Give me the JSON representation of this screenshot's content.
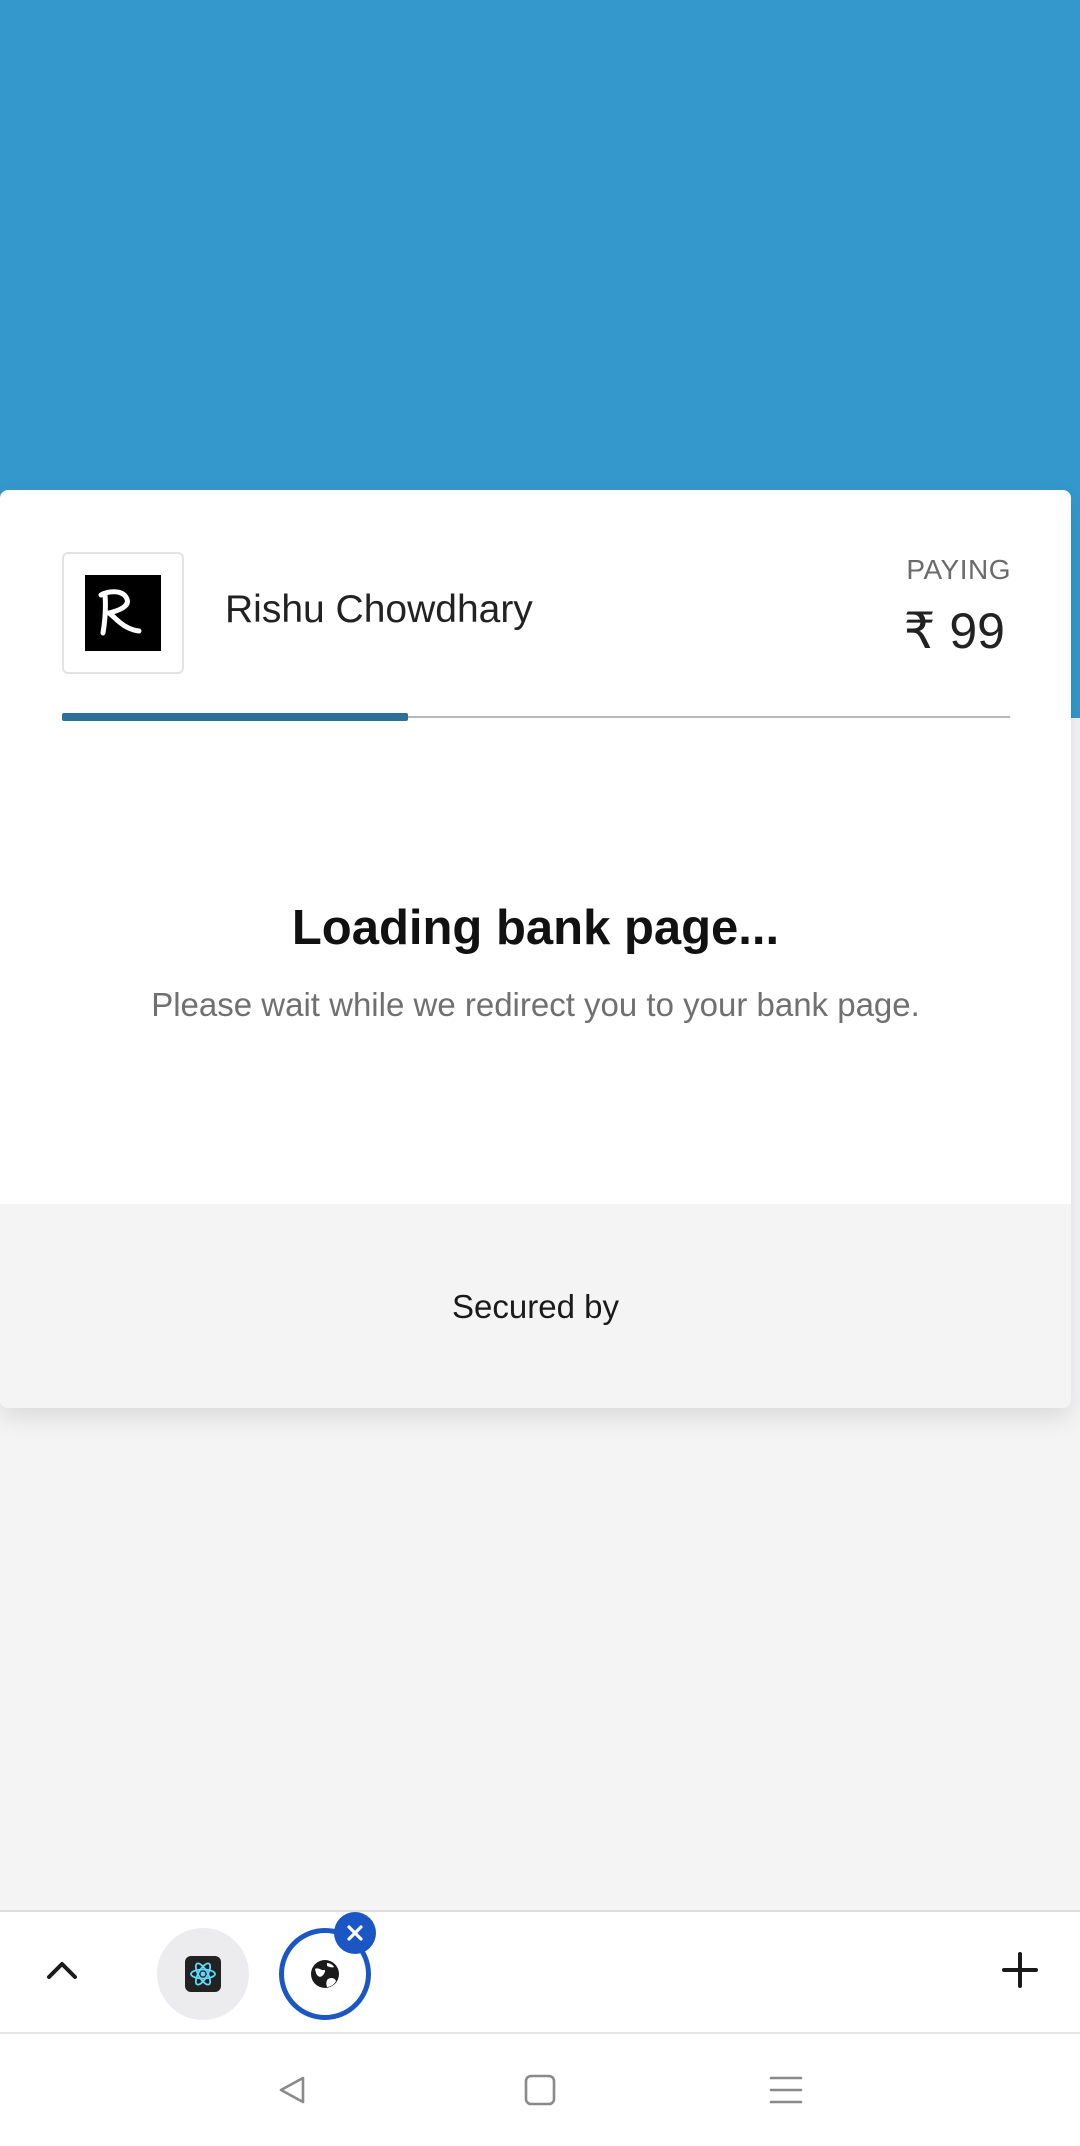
{
  "merchant": {
    "name": "Rishu Chowdhary",
    "logo_text": "R"
  },
  "payment": {
    "paying_label": "PAYING",
    "amount": "₹ 99"
  },
  "progress": {
    "value_percent": 36.5
  },
  "status": {
    "title": "Loading bank page...",
    "subtitle": "Please wait while we redirect you to your bank page."
  },
  "footer": {
    "secured_by": "Secured by"
  },
  "colors": {
    "header_band": "#3498cc",
    "progress_fill": "#2c6f97",
    "tab_accent": "#1a56c4"
  },
  "tab_bar": {
    "icons": [
      "chevron-up-icon",
      "react-atom-icon",
      "globe-icon",
      "close-icon",
      "plus-icon"
    ]
  },
  "nav_bar": {
    "icons": [
      "back-triangle-icon",
      "home-square-icon",
      "menu-lines-icon"
    ]
  }
}
